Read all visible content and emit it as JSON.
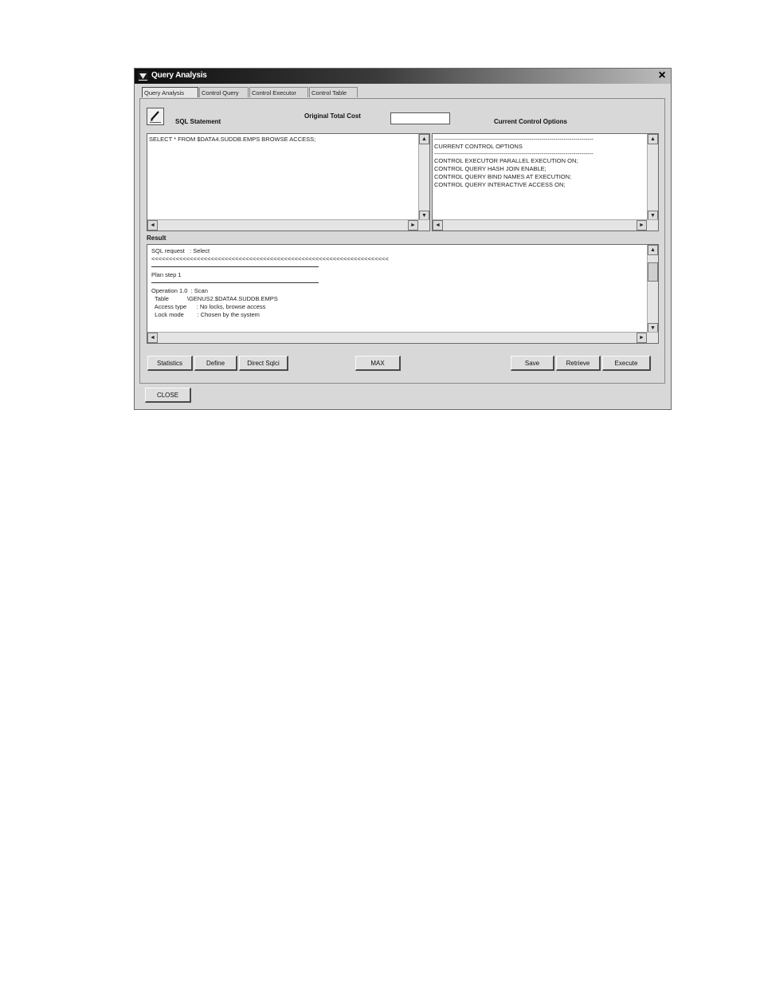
{
  "window": {
    "title": "Query Analysis",
    "close_glyph": "×"
  },
  "tabs": [
    {
      "label": "Query Analysis",
      "active": true
    },
    {
      "label": "Control Query"
    },
    {
      "label": "Control Executor"
    },
    {
      "label": "Control Table"
    }
  ],
  "sql": {
    "label": "SQL Statement",
    "text": "SELECT * FROM $DATA4.SUDDB.EMPS BROWSE ACCESS;"
  },
  "cost": {
    "label": "Original Total Cost",
    "value": ""
  },
  "control_options": {
    "label": "Current Control Options",
    "lines": [
      "--------------------------------------------------------------------------------",
      "CURRENT CONTROL OPTIONS",
      "--------------------------------------------------------------------------------",
      "CONTROL EXECUTOR PARALLEL EXECUTION ON;",
      "CONTROL QUERY HASH JOIN ENABLE;",
      "CONTROL QUERY BIND NAMES AT EXECUTION;",
      "CONTROL QUERY INTERACTIVE ACCESS ON;"
    ]
  },
  "result": {
    "label": "Result",
    "lines": [
      "SQL request   : Select",
      "<<<<<<<<<<<<<<<<<<<<<<<<<<<<<<<<<<<<<<<<<<<<<<<<<<<<<<<<<<<<<<<<<<<<",
      "",
      "Plan step 1",
      "",
      "Operation 1.0  : Scan",
      "  Table           \\GENUS2.$DATA4.SUDDB.EMPS",
      "  Access type      : No locks, browse access",
      "  Lock mode        : Chosen by the system"
    ]
  },
  "buttons": {
    "statistics": "Statistics",
    "define": "Define",
    "direct_sql": "Direct Sqlci",
    "max": "MAX",
    "save": "Save",
    "retrieve": "Retrieve",
    "execute": "Execute",
    "close": "CLOSE"
  },
  "scroll": {
    "up": "▲",
    "down": "▼",
    "left": "◄",
    "right": "►"
  }
}
